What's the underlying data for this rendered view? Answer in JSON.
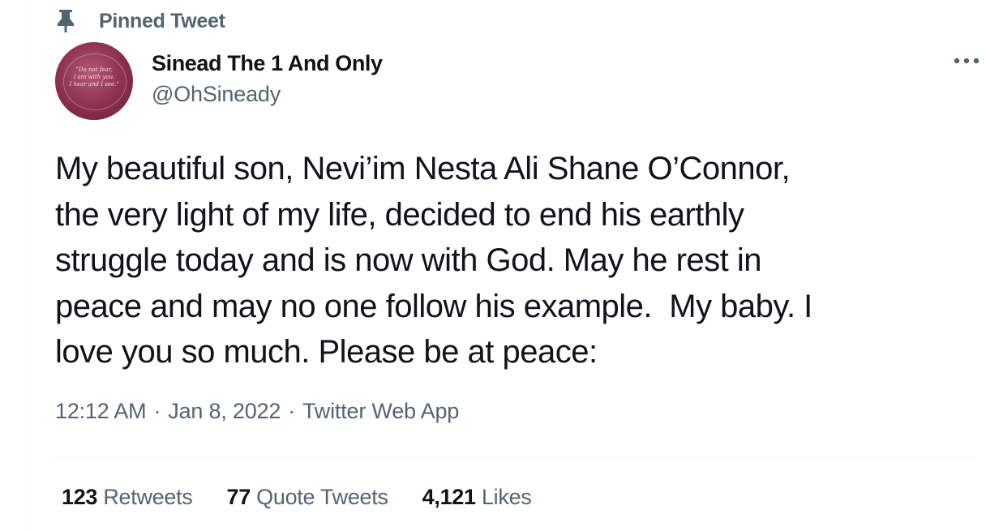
{
  "pinned": {
    "label": "Pinned Tweet",
    "icon": "pin-icon"
  },
  "author": {
    "display_name": "Sinead The 1 And Only",
    "handle": "@OhSineady",
    "avatar_text": "\"Do not fear,\nI am with you.\nI hear and I see.\""
  },
  "more_menu": {
    "icon": "more-horizontal-icon"
  },
  "tweet": {
    "text": "My beautiful son, Nevi’im Nesta Ali Shane O’Connor,\nthe very light of my life, decided to end his earthly\nstruggle today and is now with God. May he rest in\npeace and may no one follow his example.  My baby. I\nlove you so much. Please be at peace:"
  },
  "meta": {
    "time": "12:12 AM",
    "separator": "·",
    "date": "Jan 8, 2022",
    "source": "Twitter Web App"
  },
  "stats": {
    "retweets_count": "123",
    "retweets_label": "Retweets",
    "quotes_count": "77",
    "quotes_label": "Quote Tweets",
    "likes_count": "4,121",
    "likes_label": "Likes"
  },
  "colors": {
    "text_primary": "#0f1419",
    "text_secondary": "#536471",
    "divider": "#eff3f4",
    "avatar": "#8a2f4c"
  }
}
